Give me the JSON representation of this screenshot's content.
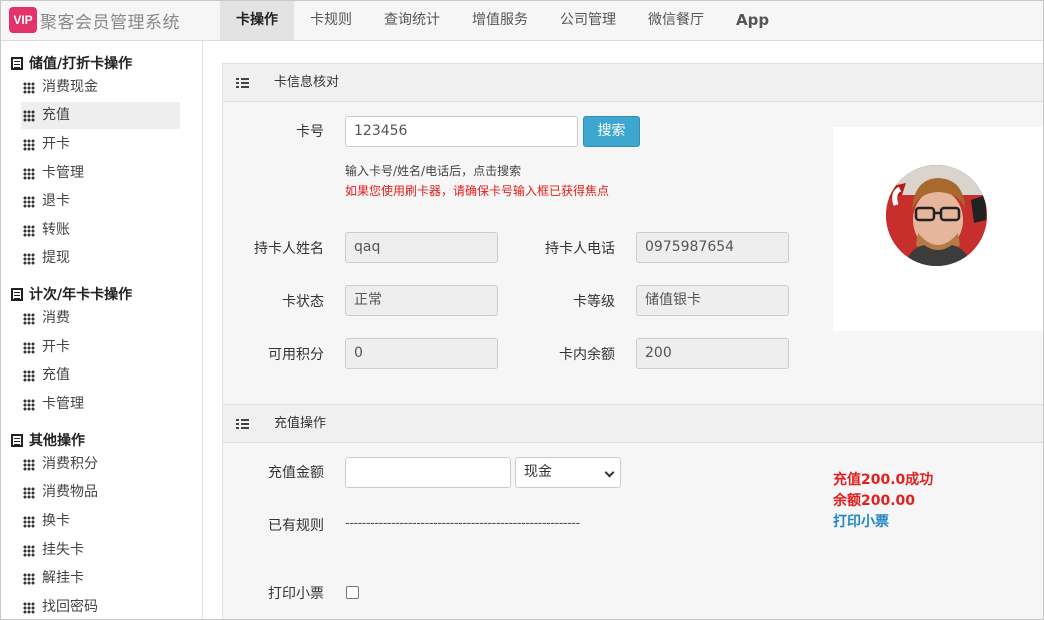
{
  "app": {
    "logo_badge": "VIP",
    "title": "聚客会员管理系统"
  },
  "nav": [
    "卡操作",
    "卡规则",
    "查询统计",
    "增值服务",
    "公司管理",
    "微信餐厅",
    "App"
  ],
  "sidebar": {
    "groups": [
      {
        "title": "储值/打折卡操作",
        "items": [
          "消费现金",
          "充值",
          "开卡",
          "卡管理",
          "退卡",
          "转账",
          "提现"
        ]
      },
      {
        "title": "计次/年卡卡操作",
        "items": [
          "消费",
          "开卡",
          "充值",
          "卡管理"
        ]
      },
      {
        "title": "其他操作",
        "items": [
          "消费积分",
          "消费物品",
          "换卡",
          "挂失卡",
          "解挂卡",
          "找回密码"
        ]
      }
    ],
    "active_item": "充值"
  },
  "card_info": {
    "title": "卡信息核对",
    "card_no_label": "卡号",
    "card_no_value": "123456",
    "search_button": "搜索",
    "hint1": "输入卡号/姓名/电话后，点击搜索",
    "hint2": "如果您使用刷卡器，请确保卡号输入框已获得焦点",
    "holder_name_label": "持卡人姓名",
    "holder_name": "qaq",
    "holder_phone_label": "持卡人电话",
    "holder_phone": "0975987654",
    "status_label": "卡状态",
    "status": "正常",
    "level_label": "卡等级",
    "level": "储值银卡",
    "points_label": "可用积分",
    "points": "0",
    "balance_label": "卡内余额",
    "balance": "200"
  },
  "recharge": {
    "title": "充值操作",
    "amount_label": "充值金额",
    "amount_value": "",
    "payment_method": "现金",
    "rules_label": "已有规则",
    "rules_value": "--------------------------------------------------------",
    "print_label": "打印小票",
    "print_checked": false,
    "result_line1": "充值200.0成功",
    "result_line2": "余额200.00",
    "print_link": "打印小票"
  },
  "colors": {
    "accent": "#3ea7cf",
    "error": "#e0201f",
    "brand": "#e2336b",
    "link": "#1e88c6"
  }
}
